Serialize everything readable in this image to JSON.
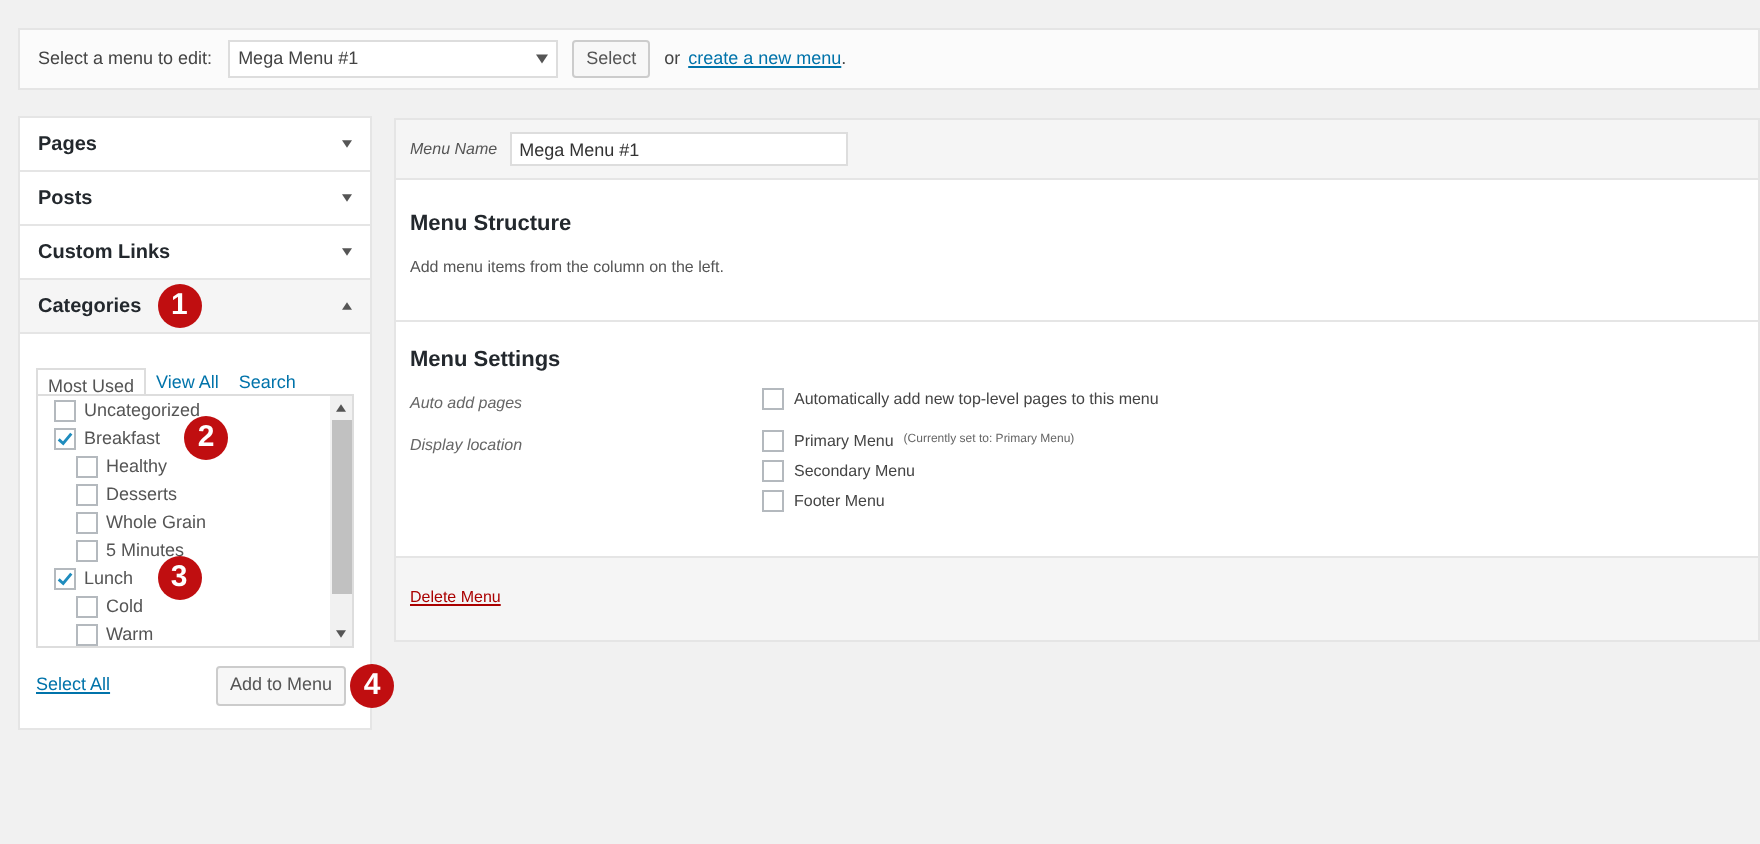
{
  "menu_picker": {
    "label": "Select a menu to edit:",
    "value": "Mega Menu #1",
    "button": "Select",
    "or_text": "or",
    "create_link": "create a new menu",
    "period": "."
  },
  "sidebar": {
    "panels": [
      {
        "title": "Pages",
        "expanded": false
      },
      {
        "title": "Posts",
        "expanded": false
      },
      {
        "title": "Custom Links",
        "expanded": false
      },
      {
        "title": "Categories",
        "expanded": true,
        "badge": "1"
      }
    ],
    "tabs": [
      {
        "label": "Most Used",
        "selected": true
      },
      {
        "label": "View All",
        "selected": false
      },
      {
        "label": "Search",
        "selected": false
      }
    ],
    "categories": [
      {
        "label": "Uncategorized",
        "checked": false
      },
      {
        "label": "Breakfast",
        "checked": true,
        "badge": "2",
        "children": [
          {
            "label": "Healthy",
            "checked": false
          },
          {
            "label": "Desserts",
            "checked": false
          },
          {
            "label": "Whole Grain",
            "checked": false
          },
          {
            "label": "5 Minutes",
            "checked": false
          }
        ]
      },
      {
        "label": "Lunch",
        "checked": true,
        "badge": "3",
        "children": [
          {
            "label": "Cold",
            "checked": false
          },
          {
            "label": "Warm",
            "checked": false
          }
        ]
      }
    ],
    "select_all": "Select All",
    "add_button": "Add to Menu",
    "add_badge": "4"
  },
  "editor": {
    "name_label": "Menu Name",
    "name_value": "Mega Menu #1",
    "structure_title": "Menu Structure",
    "structure_hint": "Add menu items from the column on the left.",
    "settings_title": "Menu Settings",
    "settings": [
      {
        "label": "Auto add pages",
        "options": [
          {
            "label": "Automatically add new top-level pages to this menu",
            "checked": false
          }
        ]
      },
      {
        "label": "Display location",
        "options": [
          {
            "label": "Primary Menu",
            "note": "(Currently set to: Primary Menu)",
            "checked": false
          },
          {
            "label": "Secondary Menu",
            "checked": false
          },
          {
            "label": "Footer Menu",
            "checked": false
          }
        ]
      }
    ],
    "delete_link": "Delete Menu"
  }
}
